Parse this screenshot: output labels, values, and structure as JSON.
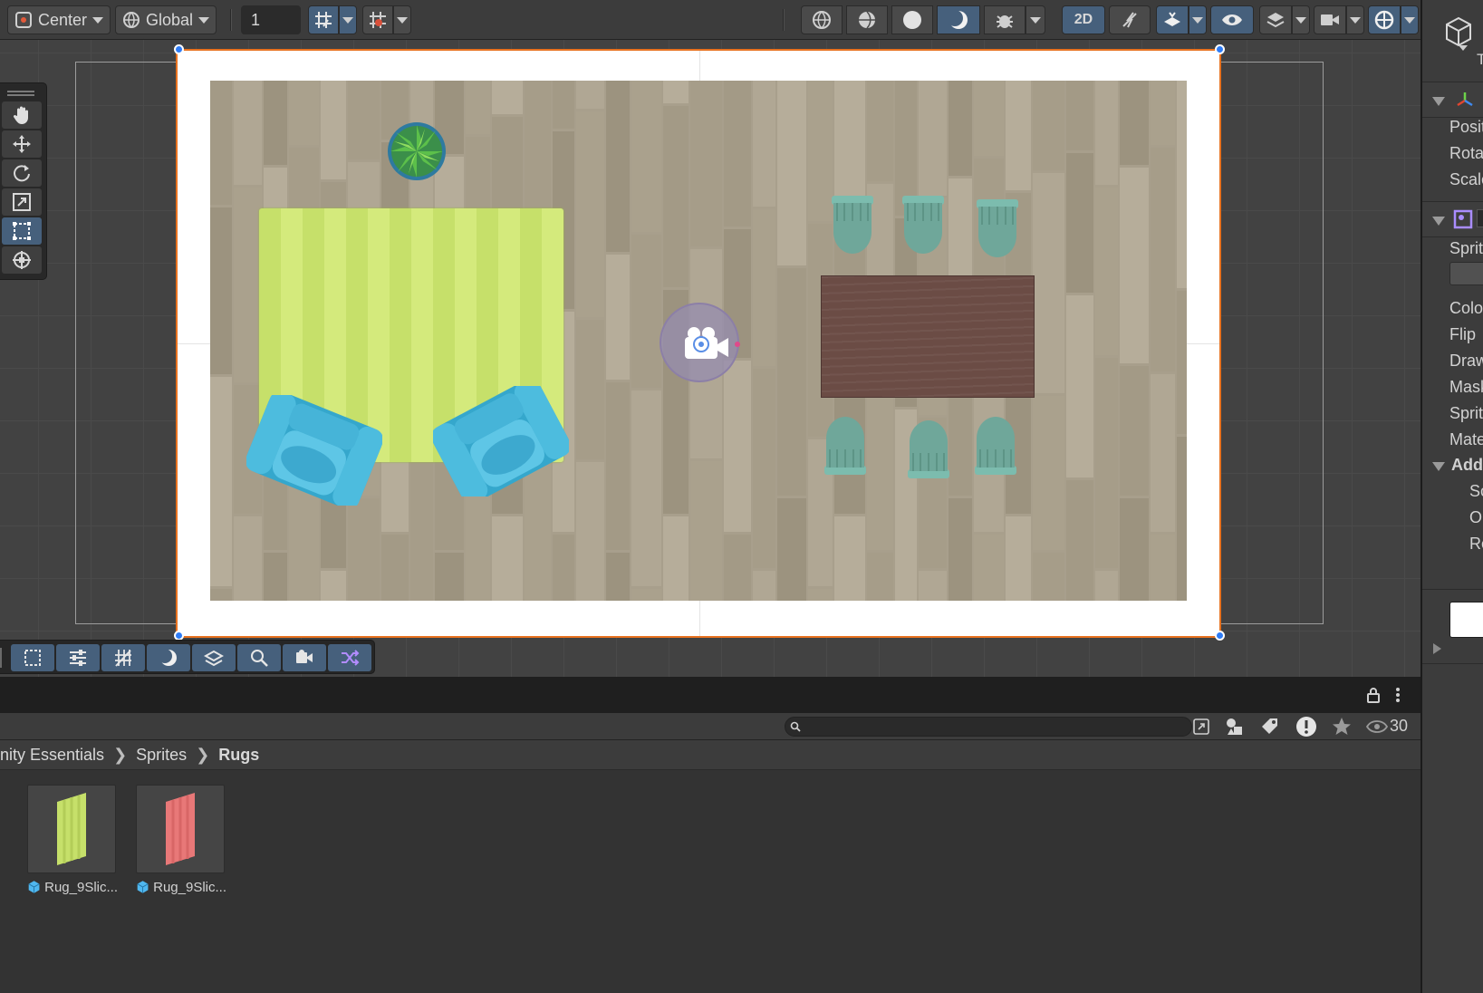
{
  "toolbar": {
    "pivot_mode": "Center",
    "pivot_rotation": "Global",
    "grid_increment": "1",
    "view_2d_label": "2D",
    "icons": [
      "pivot-icon",
      "global-icon",
      "grid-snap-icon",
      "increment-snap-icon",
      "wireframe-icon",
      "shaded-wireframe-icon",
      "shaded-icon",
      "lit-icon",
      "debug-icon",
      "2d-toggle",
      "lighting-toggle-icon",
      "scene-fx-icon",
      "visibility-icon",
      "layers-icon",
      "camera-icon",
      "gizmos-icon"
    ]
  },
  "tools": [
    "hand-tool",
    "move-tool",
    "rotate-tool",
    "scale-tool",
    "rect-tool",
    "transform-tool"
  ],
  "overlays": [
    "rect-overlay",
    "toolbar-overlay",
    "grid-overlay",
    "draw-mode-overlay",
    "sprite-shape-overlay",
    "search-overlay",
    "camera-overlay",
    "transform-overlay"
  ],
  "scene": {
    "objects": [
      "plant",
      "rug-green",
      "armchair-left",
      "armchair-right",
      "dining-table",
      "chair-top-1",
      "chair-top-2",
      "chair-top-3",
      "chair-bottom-1",
      "chair-bottom-2",
      "chair-bottom-3",
      "camera-gizmo"
    ],
    "colors": {
      "selection": "#e8721f",
      "floor": "#a89f8c",
      "rug": "#c6e06a",
      "armchair": "#3fb1d4",
      "chair": "#6fa79a",
      "table": "#6b4c45",
      "handle": "#2e7cf6"
    }
  },
  "project": {
    "search_placeholder": "",
    "visible_count": "30",
    "breadcrumb": [
      "nity Essentials",
      "Sprites",
      "Rugs"
    ],
    "assets": [
      {
        "label": "Rug_9Slic...",
        "color": "#c6e06a"
      },
      {
        "label": "Rug_9Slic...",
        "color": "#e87878"
      }
    ]
  },
  "inspector": {
    "header_letter": "T",
    "transform_rows": [
      "Posit",
      "Rota",
      "Scale"
    ],
    "sprite_rows": [
      "Sprit",
      "Colo",
      "Flip",
      "Draw",
      "Mask",
      "Sprit",
      "Mate"
    ],
    "additional_label": "Addi",
    "additional_rows": [
      "Sc",
      "Or",
      "Re"
    ]
  }
}
